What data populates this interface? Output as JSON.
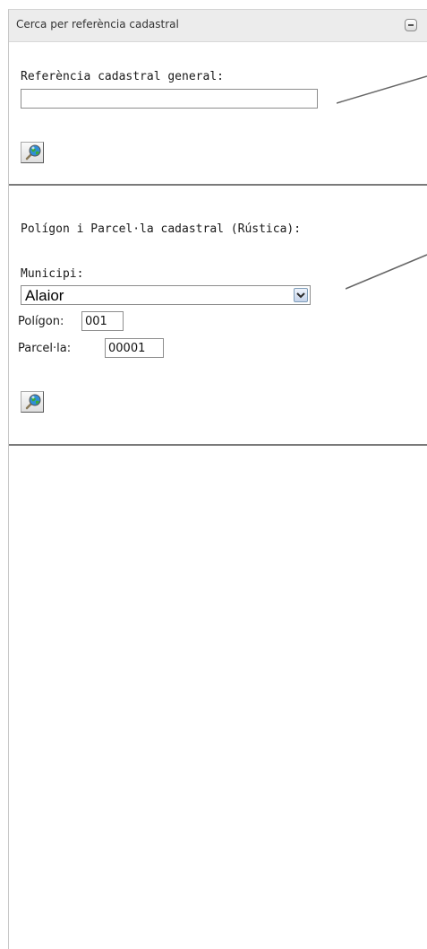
{
  "panel": {
    "title": "Cerca per referència cadastral",
    "collapse_icon": "minus-icon"
  },
  "section_general": {
    "label": "Referència cadastral general:",
    "input_value": "",
    "search_icon": "magnifier-globe-icon"
  },
  "section_rustica": {
    "heading": "Polígon i Parcel·la cadastral (Rústica):",
    "municipi_label": "Municipi:",
    "municipi_selected": "Alaior",
    "poligon_label": "Polígon:",
    "poligon_value": "001",
    "parcela_label": "Parcel·la:",
    "parcela_value": "00001",
    "search_icon": "magnifier-globe-icon"
  },
  "colors": {
    "header_bg": "#ececec",
    "divider": "#7a7a7a",
    "input_border": "#8d8d8d"
  }
}
